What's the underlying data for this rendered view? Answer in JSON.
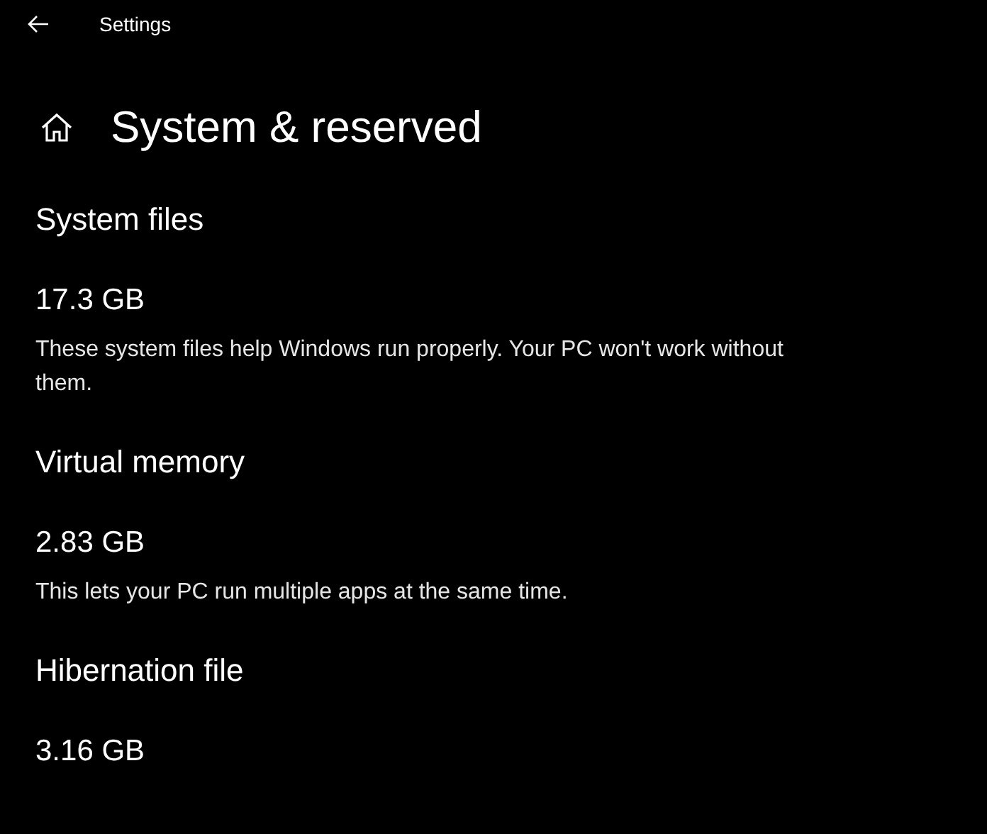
{
  "window": {
    "title": "Settings"
  },
  "page": {
    "title": "System & reserved"
  },
  "sections": [
    {
      "title": "System files",
      "size": "17.3 GB",
      "description": "These system files help Windows run properly. Your PC won't work without them."
    },
    {
      "title": "Virtual memory",
      "size": "2.83 GB",
      "description": "This lets your PC run multiple apps at the same time."
    },
    {
      "title": "Hibernation file",
      "size": "3.16 GB"
    }
  ]
}
